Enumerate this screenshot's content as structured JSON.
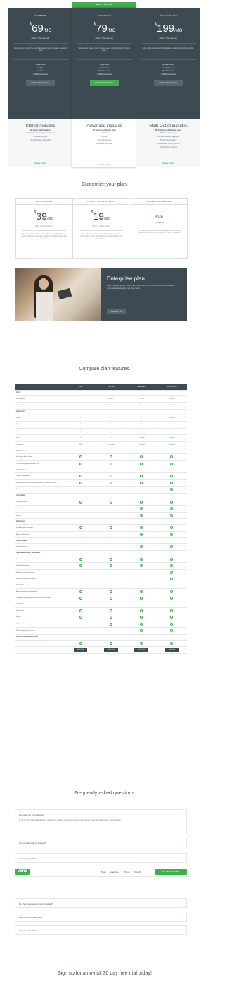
{
  "badge": "MOST POPULAR",
  "plans": [
    {
      "name": "STARTER",
      "currency": "$",
      "price": "69",
      "per": "/MO",
      "billed": "Billed in USD annually",
      "blurb": "Build your best store. The essential features to sell, manage, market & grow.",
      "features": [
        "Single outlet",
        "1 register",
        "2 users",
        "Unlimited products"
      ],
      "cta": "START FREE TRIAL",
      "includes": "Starter includes",
      "includes_sub": "All these great features:",
      "light_features": [
        "Professional inventory management",
        "Customer profiles",
        "Small Business Reporting"
      ],
      "compare": "Compare plans"
    },
    {
      "name": "ADVANCED",
      "currency": "$",
      "price": "79",
      "per": "/MO",
      "billed": "Billed in USD annually",
      "blurb": "Take retail to the next level. Increase sales, optimise inventory & drive profit.",
      "features": [
        "Single outlet",
        "1 register (+)",
        "Unlimited users",
        "Unlimited products"
      ],
      "cta": "START FREE TRIAL",
      "includes": "Advanced includes",
      "includes_sub": "All features in Starter, plus:",
      "light_features": [
        "Gift Cards",
        "Loyalty",
        "Vend Ecommerce",
        "Advanced Reporting"
      ],
      "compare": "Compare plans"
    },
    {
      "name": "MULTI-OUTLET",
      "currency": "$",
      "price": "199",
      "per": "/MO",
      "billed": "Billed in USD annually",
      "blurb": "Multi-outlet management. Streamline operations & maximise profits.",
      "features": [
        "Multiple outlets",
        "3 registers (+)",
        "Unlimited users",
        "Unlimited products"
      ],
      "cta": "START FREE TRIAL",
      "includes": "Multi-Outlet includes",
      "includes_sub": "All features in Advanced, plus:",
      "light_features": [
        "Multi-outlet inventory",
        "Central customer database",
        "HQ & outlet reporting",
        "Consolidated billing & admin",
        "Priority Phone Support"
      ],
      "compare": "Compare plans"
    }
  ],
  "customize_title": "Customize your plan.",
  "addons": [
    {
      "head": "ADD A REGISTER",
      "currency": "$",
      "price": "39",
      "per": "/MO",
      "billed": "Billed in USD annually",
      "desc": "All plans include one free retail register (two for Multi-Outlet). Extra registers can be added to Advanced or Multi-Outlet plans at any time."
    },
    {
      "head": "PRIORITY PHONE SUPPORT",
      "currency": "$",
      "price": "19",
      "per": "/MO",
      "billed": "Billed in USD monthly",
      "desc": "Skip to the front of the line with Priority Phone Support. Included for free with Multi-Outlet plans, and at $19/mo for Advanced plans."
    },
    {
      "head": "PROFESSIONAL SERVICES",
      "price": "POA",
      "link": "Contact us",
      "desc": "Let our team of expert partners do the heavy lifting to set up your new Vend store, or train your staff in how to use Vend."
    }
  ],
  "enterprise": {
    "title": "Enterprise plan.",
    "desc": "Need a tailored solution? We're here to help. Get in touch with us and we can provide a personalised package to meet your needs.",
    "cta": "CONTACT US"
  },
  "compare_title": "Compare plan features.",
  "table": {
    "columns": [
      "FREE",
      "STARTER",
      "ADVANCED",
      "MULTI-OUTLET"
    ],
    "rows": [
      {
        "s": "PRICE"
      },
      {
        "l": "Paid annually",
        "v": [
          "-",
          "$69/mo",
          "$79/mo",
          "$199/mo"
        ]
      },
      {
        "l": "Paid monthly",
        "v": [
          "-",
          "$99/mo",
          "$99/mo",
          "$249/mo"
        ]
      },
      {
        "s": "PLAN LIMITS"
      },
      {
        "l": "Outlets",
        "v": [
          "1",
          "1",
          "1",
          "Unlimited"
        ]
      },
      {
        "l": "Registers",
        "v": [
          "1",
          "1",
          "1 (+)",
          "3 (+)"
        ]
      },
      {
        "l": "Products",
        "v": [
          "10",
          "Unlimited",
          "Unlimited",
          "Unlimited"
        ]
      },
      {
        "l": "Users",
        "v": [
          "1",
          "2",
          "Unlimited",
          "Unlimited"
        ]
      },
      {
        "l": "Customers",
        "v": [
          "1000",
          "Unlimited",
          "Unlimited",
          "Unlimited"
        ]
      },
      {
        "s": "POINT OF SALE"
      },
      {
        "l": "Sell on any device (iPad)",
        "v": [
          "c",
          "c",
          "c",
          "c"
        ]
      },
      {
        "l": "Continue Selling always offline sing",
        "v": [
          "c",
          "c",
          "c",
          "c"
        ]
      },
      {
        "s": "INVENTORY"
      },
      {
        "l": "Product management",
        "v": [
          "c",
          "c",
          "c",
          "c"
        ]
      },
      {
        "l": "Basic control (orders & returns, payment, full inventory counts)",
        "v": [
          "c",
          "c",
          "c",
          "c"
        ]
      },
      {
        "l": "Basic transfer between outlets",
        "v": [
          "",
          "",
          "",
          "c"
        ]
      },
      {
        "s": "CUSTOMERS"
      },
      {
        "l": "Customer profiles",
        "v": [
          "c",
          "c",
          "c",
          "c"
        ]
      },
      {
        "l": "Gift cards",
        "v": [
          "",
          "",
          "c",
          "c"
        ]
      },
      {
        "l": "Loyalty",
        "v": [
          "",
          "",
          "c",
          "c"
        ]
      },
      {
        "s": "REPORTING"
      },
      {
        "l": "Small Business Reporting",
        "v": [
          "c",
          "c",
          "c",
          "c"
        ]
      },
      {
        "l": "Advanced Reporting",
        "v": [
          "",
          "",
          "c",
          "c"
        ]
      },
      {
        "s": "OMNICHANNEL"
      },
      {
        "l": "Vend Ecommerce",
        "v": [
          "",
          "",
          "c",
          "c"
        ]
      },
      {
        "s": "USER MANAGEMENT AND ADMIN"
      },
      {
        "l": "Admin, manager and cashier user accounts",
        "v": [
          "c",
          "c",
          "c",
          "c"
        ]
      },
      {
        "l": "Sales targets by user",
        "v": [
          "c",
          "c",
          "c",
          "c"
        ]
      },
      {
        "l": "Multi-outlet user restrictions",
        "v": [
          "-",
          "-",
          "-",
          "c"
        ]
      },
      {
        "l": "Multi-outlet enterprise support",
        "v": [
          "-",
          "-",
          "-",
          "c"
        ]
      },
      {
        "s": "PAYMENTS"
      },
      {
        "l": "Accept integrated card payments",
        "v": [
          "c",
          "c",
          "c",
          "c"
        ]
      },
      {
        "l": "Integrated card payments available in select countries",
        "v": [
          "c",
          "c",
          "c",
          "c"
        ]
      },
      {
        "s": "SUPPORT"
      },
      {
        "l": "Help Center",
        "v": [
          "c",
          "c",
          "c",
          "c"
        ]
      },
      {
        "l": "Vend U",
        "v": [
          "c",
          "c",
          "c",
          "c"
        ]
      },
      {
        "l": "24/7 Email & chat support",
        "v": [
          "",
          "c",
          "c",
          "c"
        ]
      },
      {
        "l": "24/7 Priority Phone Support",
        "v": [
          "",
          "",
          "c",
          "c"
        ]
      },
      {
        "s": "INTEGRATIONS AND ADD ONS"
      },
      {
        "l": "Connect Vend with Xero, Shopify and more with our",
        "v": [
          "c",
          "c",
          "c",
          "c"
        ]
      }
    ],
    "buttons": [
      "Start Trial",
      "Start Trial",
      "Start Trial",
      "Start Trial"
    ]
  },
  "faq_title": "Frequently asked questions.",
  "faqs": [
    {
      "q": "How does the free trial work?",
      "a": "Try all of Vend's features for 30 days in order for you to assess your account. You can also continue to use Vend at no charge on the Free plan."
    },
    {
      "q": "How do I activate my account?"
    },
    {
      "q": "Can I change plans?"
    },
    {
      "q": "Need a tailored solution?"
    },
    {
      "q": "Do I have to sign a long term contract?"
    },
    {
      "q": "Does Vend run franchises?"
    },
    {
      "q": "Any other questions?"
    }
  ],
  "nav": {
    "logo": "vend",
    "links": [
      "Tour",
      "Examples",
      "Pricing",
      "More"
    ],
    "cta": "TRY VEND FOR FREE"
  },
  "signup_title": "Sign up for a no-risk 30 day free trial today!"
}
